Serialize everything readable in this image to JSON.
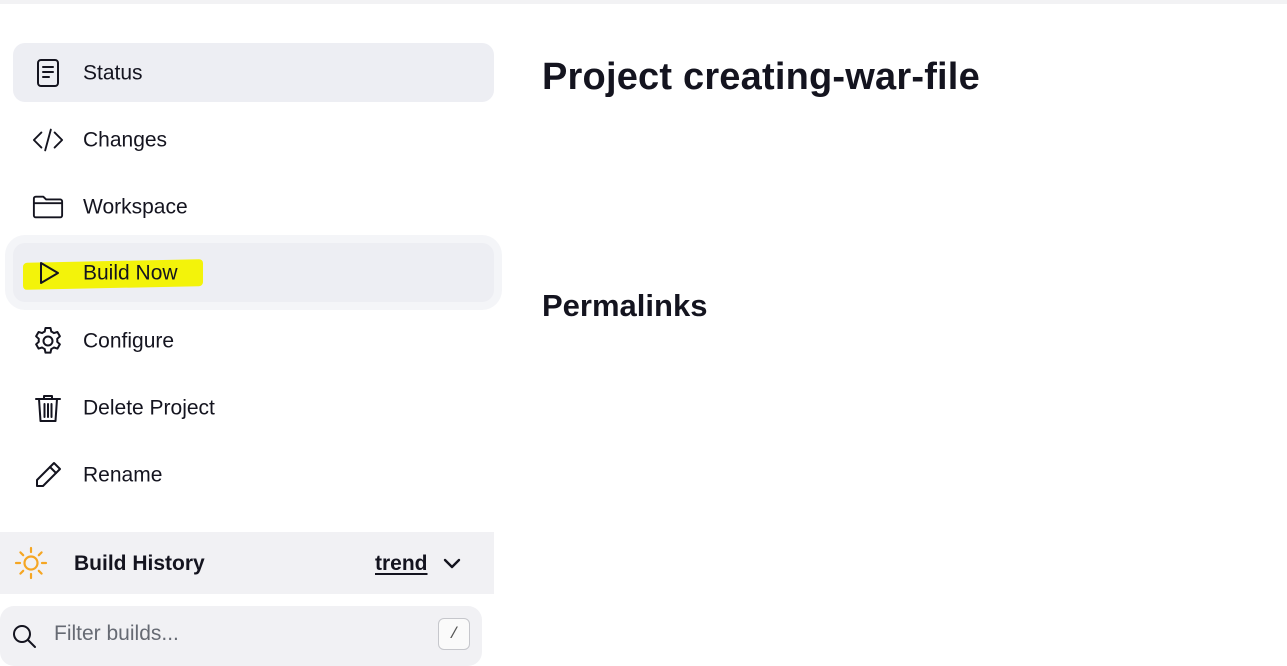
{
  "sidebar": {
    "items": [
      {
        "label": "Status",
        "icon": "document-icon"
      },
      {
        "label": "Changes",
        "icon": "code-icon"
      },
      {
        "label": "Workspace",
        "icon": "folder-icon"
      },
      {
        "label": "Build Now",
        "icon": "play-icon"
      },
      {
        "label": "Configure",
        "icon": "gear-icon"
      },
      {
        "label": "Delete Project",
        "icon": "trash-icon"
      },
      {
        "label": "Rename",
        "icon": "pencil-icon"
      }
    ]
  },
  "build_history": {
    "title": "Build History",
    "trend_label": "trend",
    "icon": "sun-icon",
    "icon_color": "#f5a623"
  },
  "filter": {
    "placeholder": "Filter builds...",
    "shortcut": "/"
  },
  "main": {
    "title": "Project creating-war-file",
    "permalinks_heading": "Permalinks"
  },
  "colors": {
    "highlight": "#f3f30a",
    "active_bg": "#edeef3",
    "text": "#14141f"
  }
}
